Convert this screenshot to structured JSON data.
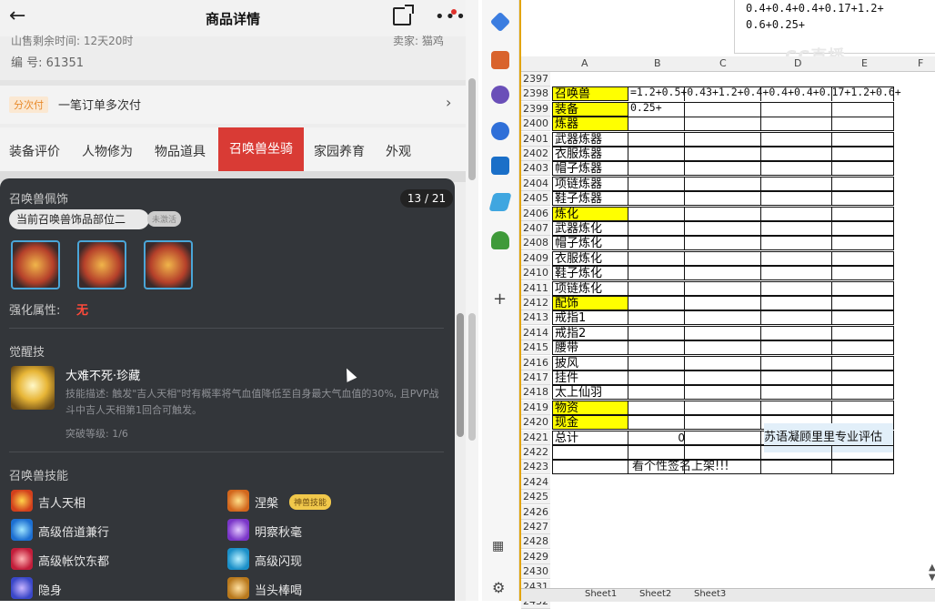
{
  "phone": {
    "title": "商品详情",
    "cut_line": "山售剩余时间: 12天20时",
    "cut_right": "卖家: 猫鸡",
    "serial": "编 号: 61351",
    "pay_tag": "分次付",
    "pay_text": "一笔订单多次付",
    "tabs": [
      "装备评价",
      "人物修为",
      "物品道具",
      "召唤兽坐骑",
      "家园养育",
      "外观"
    ],
    "active_tab": "召唤兽坐骑"
  },
  "sheet": {
    "section_accessory": "召唤兽佩饰",
    "counter": "13 / 21",
    "part_label": "当前召唤兽饰品部位二",
    "unlock_tag": "未激活",
    "strengthen_label": "强化属性:",
    "strengthen_value": "无",
    "awaken_title": "觉醒技",
    "awaken_skill_name": "大难不死·珍藏",
    "awaken_skill_desc": "技能描述: 触发\"吉人天相\"时有概率将气血值降低至自身最大气血值的30%, 且PVP战斗中吉人天相第1回合可触发。",
    "awaken_level": "突破等级: 1/6",
    "skills_title": "召唤兽技能",
    "skills_left": [
      "吉人天相",
      "高级倍道兼行",
      "高级帐饮东都",
      "隐身"
    ],
    "skills_right": [
      "涅槃",
      "明察秋毫",
      "高级闪现",
      "当头棒喝"
    ],
    "skill_badge": "神兽技能"
  },
  "excel": {
    "formula_lines": [
      "0.4+0.4+0.4+0.17+1.2+",
      "0.6+0.25+"
    ],
    "watermark": "CC直播",
    "columns": [
      "A",
      "B",
      "C",
      "D",
      "E",
      "F"
    ],
    "rows": [
      {
        "n": "2397",
        "a": "",
        "y": false
      },
      {
        "n": "2398",
        "a": "召唤兽",
        "y": true
      },
      {
        "n": "2399",
        "a": "装备",
        "y": true
      },
      {
        "n": "2400",
        "a": "炼器",
        "y": true
      },
      {
        "n": "2401",
        "a": "武器炼器",
        "y": false
      },
      {
        "n": "2402",
        "a": "衣服炼器",
        "y": false
      },
      {
        "n": "2403",
        "a": "帽子炼器",
        "y": false
      },
      {
        "n": "2404",
        "a": "项链炼器",
        "y": false
      },
      {
        "n": "2405",
        "a": "鞋子炼器",
        "y": false
      },
      {
        "n": "2406",
        "a": "炼化",
        "y": true
      },
      {
        "n": "2407",
        "a": "武器炼化",
        "y": false
      },
      {
        "n": "2408",
        "a": "帽子炼化",
        "y": false
      },
      {
        "n": "2409",
        "a": "衣服炼化",
        "y": false
      },
      {
        "n": "2410",
        "a": "鞋子炼化",
        "y": false
      },
      {
        "n": "2411",
        "a": "项链炼化",
        "y": false
      },
      {
        "n": "2412",
        "a": "配饰",
        "y": true
      },
      {
        "n": "2413",
        "a": "戒指1",
        "y": false
      },
      {
        "n": "2414",
        "a": "戒指2",
        "y": false
      },
      {
        "n": "2415",
        "a": "腰带",
        "y": false
      },
      {
        "n": "2416",
        "a": "披风",
        "y": false
      },
      {
        "n": "2417",
        "a": "挂件",
        "y": false
      },
      {
        "n": "2418",
        "a": "太上仙羽",
        "y": false
      },
      {
        "n": "2419",
        "a": "物资",
        "y": true
      },
      {
        "n": "2420",
        "a": "现金",
        "y": true
      },
      {
        "n": "2421",
        "a": "总计",
        "y": false
      },
      {
        "n": "2422",
        "a": "",
        "y": false
      },
      {
        "n": "2423",
        "a": "",
        "y": false
      },
      {
        "n": "2424",
        "a": "",
        "y": false
      },
      {
        "n": "2425",
        "a": "",
        "y": false
      },
      {
        "n": "2426",
        "a": "",
        "y": false
      },
      {
        "n": "2427",
        "a": "",
        "y": false
      },
      {
        "n": "2428",
        "a": "",
        "y": false
      },
      {
        "n": "2429",
        "a": "",
        "y": false
      },
      {
        "n": "2430",
        "a": "",
        "y": false
      },
      {
        "n": "2431",
        "a": "",
        "y": false
      },
      {
        "n": "2432",
        "a": "",
        "y": false
      }
    ],
    "formula_2398": "=1.2+0.5+0.43+1.2+0.4+0.4+0.4+0.17+1.2+0.6+",
    "formula_2399": "0.25+",
    "total_value": "0",
    "note": "苏语凝顾里里专业评估",
    "sign_text": "看个性签名上架!!!",
    "sheet_tabs": [
      "Sheet1",
      "Sheet2",
      "Sheet3"
    ],
    "colors": {
      "yellow": "#ffff00",
      "note_bg": "#e2eff9"
    }
  }
}
